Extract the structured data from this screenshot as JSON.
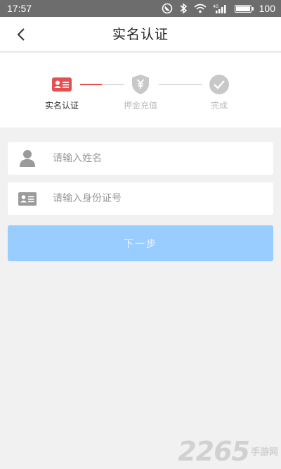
{
  "status_bar": {
    "time": "17:57",
    "signal_label": "4G",
    "battery_text": "100",
    "battery_level": 1.0
  },
  "nav": {
    "title": "实名认证",
    "back_icon": "chevron-left-icon"
  },
  "steps": [
    {
      "label": "实名认证",
      "icon": "id-card-icon",
      "state": "active",
      "color": "#e45050"
    },
    {
      "label": "押金充值",
      "icon": "shield-yen-icon",
      "state": "pending",
      "color": "#c8c8c8"
    },
    {
      "label": "完成",
      "icon": "check-circle-icon",
      "state": "pending",
      "color": "#c8c8c8"
    }
  ],
  "step_progress": 0.5,
  "form": {
    "name_placeholder": "请输入姓名",
    "name_value": "",
    "id_placeholder": "请输入身份证号",
    "id_value": "",
    "next_label": "下一步"
  },
  "colors": {
    "accent": "#e45050",
    "button_disabled": "#99ccff",
    "status_bar": "#6d6d6d"
  },
  "watermark": {
    "number": "2265",
    "suffix": "手游网"
  }
}
